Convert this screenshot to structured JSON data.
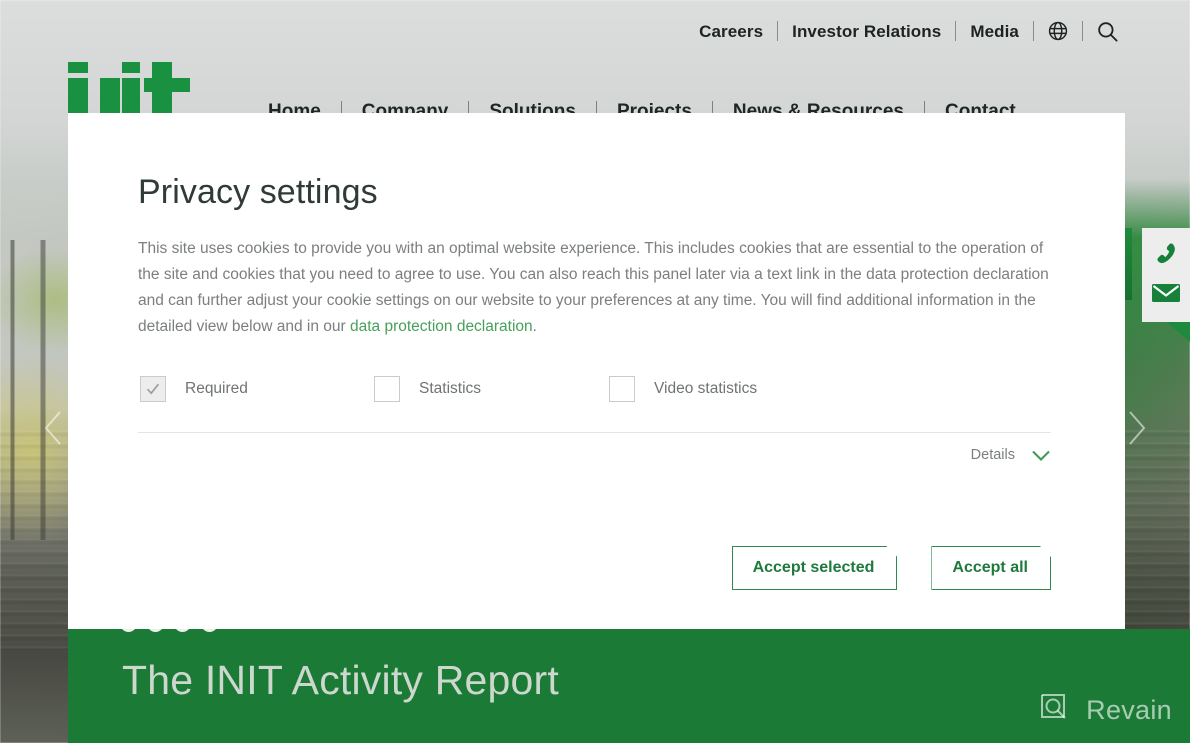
{
  "topnav": {
    "items": [
      {
        "label": "Careers"
      },
      {
        "label": "Investor Relations"
      },
      {
        "label": "Media"
      }
    ],
    "globe_icon": "globe-icon",
    "search_icon": "search-icon"
  },
  "brand": {
    "logo_text": "init"
  },
  "mainnav": {
    "items": [
      {
        "label": "Home"
      },
      {
        "label": "Company"
      },
      {
        "label": "Solutions"
      },
      {
        "label": "Projects"
      },
      {
        "label": "News & Resources"
      },
      {
        "label": "Contact"
      }
    ]
  },
  "hero": {
    "title": "The INIT Activity Report",
    "dots": 4,
    "band_color": "#1b7a35",
    "title_color": "#ccd8cd"
  },
  "side_rail": {
    "accessibility_icon": "pedestrian-icon",
    "phone_icon": "phone-icon",
    "mail_icon": "envelope-icon"
  },
  "carousel": {
    "prev_icon": "chevron-left-icon",
    "next_icon": "chevron-right-icon"
  },
  "watermark": {
    "label": "Revain",
    "icon": "revain-logo-icon"
  },
  "dialog": {
    "title": "Privacy settings",
    "body_part1": "This site uses cookies to provide you with an optimal website experience. This includes cookies that are essential to the operation of the site and cookies that you need to agree to use. You can also reach this panel later via a text link in the data protection declaration and can further adjust your cookie settings on our website to your preferences at any time. You will find additional information in the detailed view below and in our ",
    "link_text": "data protection declaration",
    "body_part2": ".",
    "options": [
      {
        "label": "Required",
        "checked": true
      },
      {
        "label": "Statistics",
        "checked": false
      },
      {
        "label": "Video statistics",
        "checked": false
      }
    ],
    "details_label": "Details",
    "details_icon": "chevron-down-icon",
    "accept_selected_label": "Accept selected",
    "accept_all_label": "Accept all",
    "accent_color": "#2e8b4e",
    "link_color": "#46a05a"
  }
}
